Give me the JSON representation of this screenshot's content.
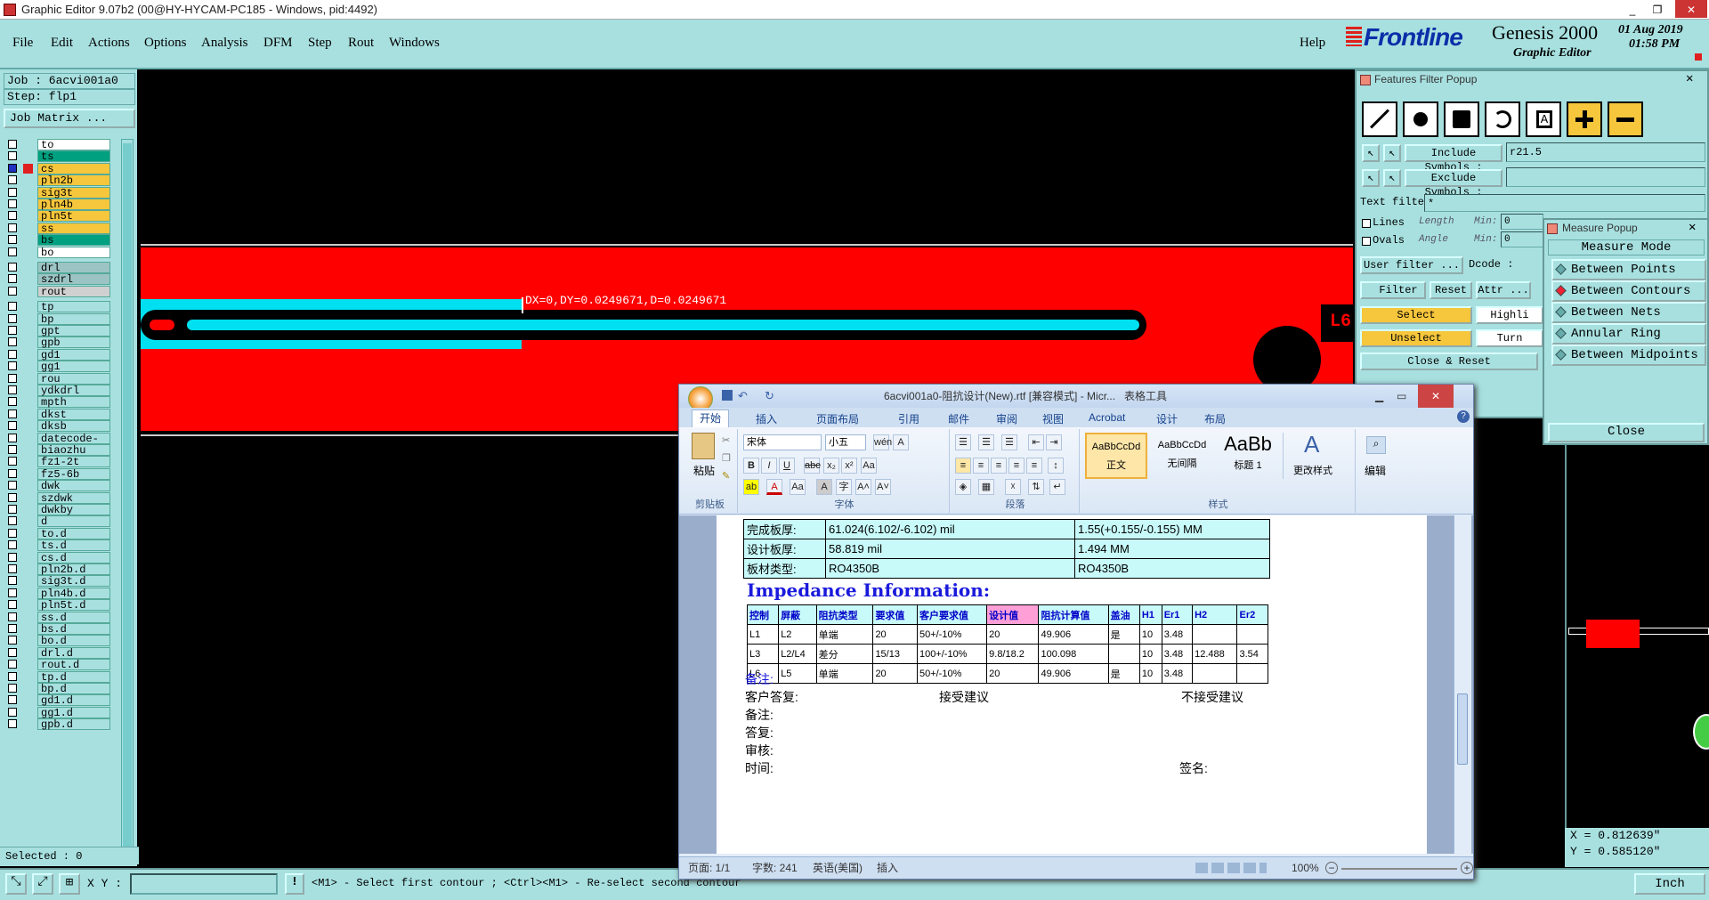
{
  "window": {
    "title": "Graphic Editor 9.07b2 (00@HY-HYCAM-PC185 - Windows, pid:4492)",
    "controls": [
      "_",
      "❐",
      "✕"
    ]
  },
  "menu": {
    "items": [
      "File",
      "Edit",
      "Actions",
      "Options",
      "Analysis",
      "DFM",
      "Step",
      "Rout",
      "Windows"
    ],
    "help": "Help"
  },
  "brand": {
    "logo": "Frontline",
    "product": "Genesis 2000",
    "subtitle": "Graphic Editor",
    "date": "01 Aug 2019",
    "time": "01:58 PM"
  },
  "left": {
    "job": "Job : 6acvi001a0",
    "step": "Step: flp1",
    "job_matrix": "Job Matrix ...",
    "layers": [
      {
        "name": "to",
        "color": "#ffffff"
      },
      {
        "name": "ts",
        "color": "#00a080"
      },
      {
        "name": "cs",
        "color": "#f6c63c",
        "active": true
      },
      {
        "name": "pln2b",
        "color": "#f6c63c"
      },
      {
        "name": "sig3t",
        "color": "#f6c63c"
      },
      {
        "name": "pln4b",
        "color": "#f6c63c"
      },
      {
        "name": "pln5t",
        "color": "#f6c63c"
      },
      {
        "name": "ss",
        "color": "#f6c63c"
      },
      {
        "name": "bs",
        "color": "#00a080"
      },
      {
        "name": "bo",
        "color": "#ffffff"
      },
      {
        "name": "drl",
        "color": "#9cc4c4",
        "gap": true
      },
      {
        "name": "szdrl",
        "color": "#9cc4c4"
      },
      {
        "name": "rout",
        "color": "#d0d0d0"
      },
      {
        "name": "tp",
        "color": "#a8e0e0",
        "gap": true
      },
      {
        "name": "bp",
        "color": "#a8e0e0"
      },
      {
        "name": "gpt",
        "color": "#a8e0e0"
      },
      {
        "name": "gpb",
        "color": "#a8e0e0"
      },
      {
        "name": "gd1",
        "color": "#a8e0e0"
      },
      {
        "name": "gg1",
        "color": "#a8e0e0"
      },
      {
        "name": "rou",
        "color": "#a8e0e0"
      },
      {
        "name": "ydkdrl",
        "color": "#a8e0e0"
      },
      {
        "name": "mpth",
        "color": "#a8e0e0"
      },
      {
        "name": "dkst",
        "color": "#a8e0e0"
      },
      {
        "name": "dksb",
        "color": "#a8e0e0"
      },
      {
        "name": "datecode-bo",
        "color": "#a8e0e0"
      },
      {
        "name": "biaozhu",
        "color": "#a8e0e0"
      },
      {
        "name": "fz1-2t",
        "color": "#a8e0e0"
      },
      {
        "name": "fz5-6b",
        "color": "#a8e0e0"
      },
      {
        "name": "dwk",
        "color": "#a8e0e0"
      },
      {
        "name": "szdwk",
        "color": "#a8e0e0"
      },
      {
        "name": "dwkby",
        "color": "#a8e0e0"
      },
      {
        "name": "d",
        "color": "#a8e0e0"
      },
      {
        "name": "to.d",
        "color": "#a8e0e0"
      },
      {
        "name": "ts.d",
        "color": "#a8e0e0"
      },
      {
        "name": "cs.d",
        "color": "#a8e0e0"
      },
      {
        "name": "pln2b.d",
        "color": "#a8e0e0"
      },
      {
        "name": "sig3t.d",
        "color": "#a8e0e0"
      },
      {
        "name": "pln4b.d",
        "color": "#a8e0e0"
      },
      {
        "name": "pln5t.d",
        "color": "#a8e0e0"
      },
      {
        "name": "ss.d",
        "color": "#a8e0e0"
      },
      {
        "name": "bs.d",
        "color": "#a8e0e0"
      },
      {
        "name": "bo.d",
        "color": "#a8e0e0"
      },
      {
        "name": "drl.d",
        "color": "#a8e0e0"
      },
      {
        "name": "rout.d",
        "color": "#a8e0e0"
      },
      {
        "name": "tp.d",
        "color": "#a8e0e0"
      },
      {
        "name": "bp.d",
        "color": "#a8e0e0"
      },
      {
        "name": "gd1.d",
        "color": "#a8e0e0"
      },
      {
        "name": "gg1.d",
        "color": "#a8e0e0"
      },
      {
        "name": "gpb.d",
        "color": "#a8e0e0"
      }
    ],
    "selected": "Selected : 0"
  },
  "canvas": {
    "measure_text": "DX=0,DY=0.0249671,D=0.0249671",
    "layer_tag": "L6"
  },
  "filter": {
    "title": "Features Filter Popup",
    "include_label": "Include Symbols :",
    "include_value": "r21.5",
    "exclude_label": "Exclude Symbols :",
    "exclude_value": "",
    "text_filter_label": "Text filter",
    "text_filter_value": "*",
    "lines": "Lines",
    "ovals": "Ovals",
    "length": "Length",
    "angle": "Angle",
    "min": "Min:",
    "min_val": "0",
    "user_filter": "User filter ...",
    "dcode": "Dcode :",
    "filter": "Filter",
    "reset": "Reset",
    "attr": "Attr ...",
    "select": "Select",
    "unselect": "Unselect",
    "highlight": "Highli",
    "turn": "Turn",
    "close_reset": "Close & Reset"
  },
  "measure": {
    "title": "Measure Popup",
    "mode": "Measure Mode",
    "options": [
      "Between Points",
      "Between Contours",
      "Between Nets",
      "Annular Ring",
      "Between Midpoints"
    ],
    "active": 1,
    "close": "Close"
  },
  "coords": {
    "x": "X = 0.812639\"",
    "y": "Y = 0.585120\"",
    "units": "Inch"
  },
  "bottom": {
    "xy_label": "X Y :",
    "hint": "<M1> - Select first contour ; <Ctrl><M1> - Re-select second contour"
  },
  "word": {
    "title": "6acvi001a0-阻抗设计(New).rtf [兼容模式] - Micr...",
    "table_tools": "表格工具",
    "tabs": [
      "开始",
      "插入",
      "页面布局",
      "引用",
      "邮件",
      "审阅",
      "视图",
      "Acrobat",
      "设计",
      "布局"
    ],
    "ribbon": {
      "paste": "粘贴",
      "clipboard": "剪贴板",
      "font_name": "宋体",
      "font_size": "小五",
      "font_group": "字体",
      "para_group": "段落",
      "styles": [
        {
          "sample": "AaBbCcDd",
          "name": "正文"
        },
        {
          "sample": "AaBbCcDd",
          "name": "无间隔"
        },
        {
          "sample": "AaBb",
          "name": "标题 1"
        }
      ],
      "change_styles": "更改样式",
      "styles_group": "样式",
      "edit": "编辑"
    },
    "board": [
      [
        "完成板厚:",
        "61.024(6.102/-6.102) mil",
        "1.55(+0.155/-0.155) MM"
      ],
      [
        "设计板厚:",
        "58.819 mil",
        "1.494 MM"
      ],
      [
        "板材类型:",
        "RO4350B",
        "RO4350B"
      ]
    ],
    "impedance_title": "Impedance Information:",
    "imp_headers": [
      "控制",
      "屏蔽",
      "阻抗类型",
      "要求值",
      "客户要求值",
      "设计值",
      "阻抗计算值",
      "盖油",
      "H1",
      "Er1",
      "H2",
      "Er2"
    ],
    "imp_rows": [
      [
        "L1",
        "L2",
        "单端",
        "20",
        "50+/-10%",
        "20",
        "49.906",
        "是",
        "10",
        "3.48",
        "",
        ""
      ],
      [
        "L3",
        "L2/L4",
        "差分",
        "15/13",
        "100+/-10%",
        "9.8/18.2",
        "100.098",
        "",
        "10",
        "3.48",
        "12.488",
        "3.54"
      ],
      [
        "L6",
        "L5",
        "单端",
        "20",
        "50+/-10%",
        "20",
        "49.906",
        "是",
        "10",
        "3.48",
        "",
        ""
      ]
    ],
    "remarks": {
      "note": "备注:",
      "reply": "客户答复:",
      "accept": "接受建议",
      "reject": "不接受建议",
      "note2": "备注:",
      "answer": "答复:",
      "audit": "审核:",
      "time": "时间:",
      "sign": "签名:"
    },
    "status": {
      "page": "页面: 1/1",
      "words": "字数: 241",
      "lang": "英语(美国)",
      "mode": "插入",
      "zoom": "100%"
    }
  }
}
